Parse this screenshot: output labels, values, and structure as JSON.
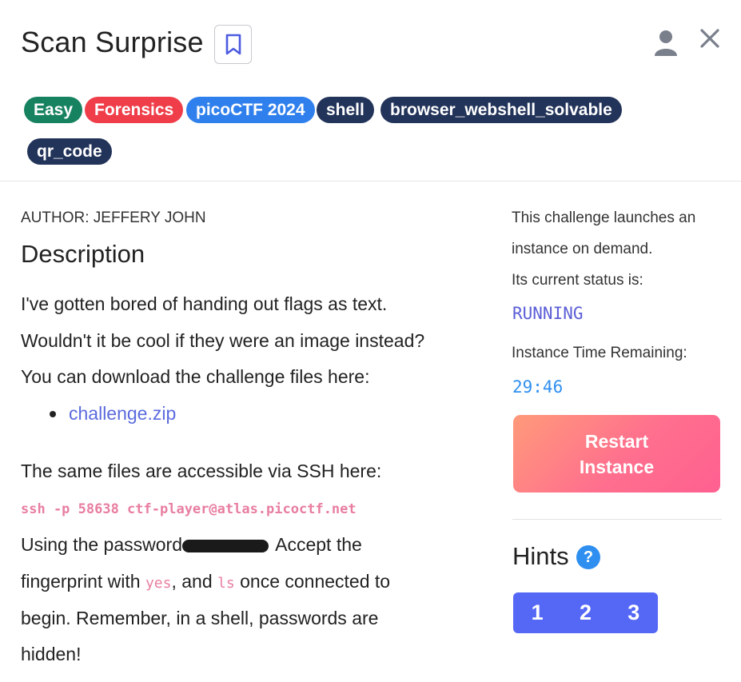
{
  "header": {
    "title": "Scan Surprise",
    "tags": [
      {
        "label": "Easy",
        "color": "#17825f"
      },
      {
        "label": "Forensics",
        "color": "#ef3e4a"
      },
      {
        "label": "picoCTF 2024",
        "color": "#2f80ed"
      },
      {
        "label": "shell",
        "color": "#23345a"
      },
      {
        "label": "browser_webshell_solvable",
        "color": "#23345a"
      },
      {
        "label": "qr_code",
        "color": "#23345a"
      }
    ]
  },
  "main": {
    "author": "AUTHOR: JEFFERY JOHN",
    "description_heading": "Description",
    "line1": "I've gotten bored of handing out flags as text.",
    "line2": "Wouldn't it be cool if they were an image instead?",
    "line3": "You can download the challenge files here:",
    "download_link": "challenge.zip",
    "ssh_intro": "The same files are accessible via SSH here:",
    "ssh_command": "ssh -p 58638 ctf-player@atlas.picoctf.net",
    "pw_prefix": "Using the password",
    "pw_suffix": " Accept the",
    "fp_prefix": "fingerprint with ",
    "fp_code1": "yes",
    "fp_middle": ", and ",
    "fp_code2": "ls",
    "fp_suffix": " once connected to",
    "line_begin": "begin. Remember, in a shell, passwords are",
    "line_hidden": "hidden!"
  },
  "sidebar": {
    "instance_line1": "This challenge launches an",
    "instance_line2": "instance on demand.",
    "status_label": "Its current status is:",
    "status_value": "RUNNING",
    "time_label": "Instance Time Remaining:",
    "time_value": "29:46",
    "restart_line1": "Restart",
    "restart_line2": "Instance",
    "hints_heading": "Hints",
    "hint_help": "?",
    "hints": [
      "1",
      "2",
      "3"
    ]
  },
  "colors": {
    "status_running": "#5b5fd6",
    "timer": "#2f8ff0",
    "accent": "#5567f5"
  }
}
